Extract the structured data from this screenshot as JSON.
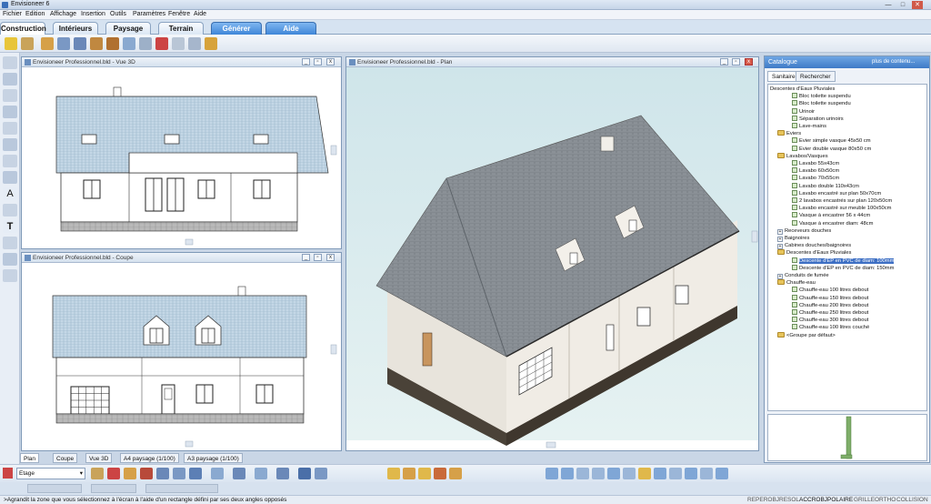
{
  "app": {
    "title": "Envisioneer 6"
  },
  "menu": [
    "Fichier",
    "Edition",
    "Affichage",
    "Insertion",
    "Outils",
    "Paramètres",
    "Fenêtre",
    "Aide"
  ],
  "tabs": [
    {
      "label": "Construction"
    },
    {
      "label": "Intérieurs"
    },
    {
      "label": "Paysage"
    },
    {
      "label": "Terrain"
    },
    {
      "label": "Générer"
    },
    {
      "label": "Aide"
    }
  ],
  "panels": {
    "vue3d": {
      "title": "Envisioneer Professionnel.bld - Vue 3D"
    },
    "coupe": {
      "title": "Envisioneer Professionnel.bld - Coupe"
    },
    "plan": {
      "title": "Envisioneer Professionnel.bld - Plan"
    }
  },
  "catalog": {
    "title": "Catalogue",
    "filter": "plus de contenu...",
    "tabs": [
      "Sanitaires",
      "Rechercher"
    ],
    "tree": [
      {
        "text": "Descentes d'Eaux Pluviales",
        "lvl": 0,
        "kind": "none"
      },
      {
        "text": "Bloc toilette suspendu",
        "lvl": 3,
        "kind": "item"
      },
      {
        "text": "Bloc toilette suspendu",
        "lvl": 3,
        "kind": "item"
      },
      {
        "text": "Urinoir",
        "lvl": 3,
        "kind": "item"
      },
      {
        "text": "Séparation urinoirs",
        "lvl": 3,
        "kind": "item"
      },
      {
        "text": "Lave-mains",
        "lvl": 3,
        "kind": "item"
      },
      {
        "text": "Eviers",
        "lvl": 1,
        "kind": "folder"
      },
      {
        "text": "Evier simple vasque 45x50 cm",
        "lvl": 3,
        "kind": "item"
      },
      {
        "text": "Evier double vasque 80x50 cm",
        "lvl": 3,
        "kind": "item"
      },
      {
        "text": "Lavabos/Vasques",
        "lvl": 1,
        "kind": "folder"
      },
      {
        "text": "Lavabo 55x43cm",
        "lvl": 3,
        "kind": "item"
      },
      {
        "text": "Lavabo 60x50cm",
        "lvl": 3,
        "kind": "item"
      },
      {
        "text": "Lavabo 70x55cm",
        "lvl": 3,
        "kind": "item"
      },
      {
        "text": "Lavabo double 110x43cm",
        "lvl": 3,
        "kind": "item"
      },
      {
        "text": "Lavabo encastré sur plan 50x70cm",
        "lvl": 3,
        "kind": "item"
      },
      {
        "text": "2 lavabos encastrés sur plan 120x50cm",
        "lvl": 3,
        "kind": "item"
      },
      {
        "text": "Lavabo encastré sur meuble 100x50cm",
        "lvl": 3,
        "kind": "item"
      },
      {
        "text": "Vasque à encastrer 56 x 44cm",
        "lvl": 3,
        "kind": "item"
      },
      {
        "text": "Vasque à encastrer diam: 48cm",
        "lvl": 3,
        "kind": "item"
      },
      {
        "text": "Receveurs douches",
        "lvl": 1,
        "kind": "plus"
      },
      {
        "text": "Baignoires",
        "lvl": 1,
        "kind": "plus"
      },
      {
        "text": "Cabines douches/baignoires",
        "lvl": 1,
        "kind": "plus"
      },
      {
        "text": "Descentes d'Eaux Pluviales",
        "lvl": 1,
        "kind": "folder"
      },
      {
        "text": "Descente d'EP en PVC de diam: 100mm",
        "lvl": 3,
        "kind": "item"
      },
      {
        "text": "Descente d'EP en PVC de diam: 150mm",
        "lvl": 3,
        "kind": "item"
      },
      {
        "text": "Conduits de fumée",
        "lvl": 1,
        "kind": "plus"
      },
      {
        "text": "Chauffe-eau",
        "lvl": 1,
        "kind": "folder"
      },
      {
        "text": "Chauffe-eau 100 litres debout",
        "lvl": 3,
        "kind": "item"
      },
      {
        "text": "Chauffe-eau 150 litres debout",
        "lvl": 3,
        "kind": "item"
      },
      {
        "text": "Chauffe-eau 200 litres debout",
        "lvl": 3,
        "kind": "item"
      },
      {
        "text": "Chauffe-eau 250 litres debout",
        "lvl": 3,
        "kind": "item"
      },
      {
        "text": "Chauffe-eau 300 litres debout",
        "lvl": 3,
        "kind": "item"
      },
      {
        "text": "Chauffe-eau 100 litres couché",
        "lvl": 3,
        "kind": "item"
      },
      {
        "text": "<Groupe par défaut>",
        "lvl": 1,
        "kind": "folder"
      }
    ]
  },
  "bottom_tabs": [
    "Plan",
    "Coupe",
    "Vue 3D",
    "A4 paysage (1/100)",
    "A3 paysage (1/100)"
  ],
  "layer": {
    "value": "Etage"
  },
  "status": {
    "hint": "Agrandit la zone que vous sélectionnez à l'écran à l'aide d'un rectangle défini par ses deux angles opposés",
    "modes": [
      "REPEROBJ",
      "RESOL",
      "ACCROBJ",
      "POLAIRE",
      "GRILLE",
      "ORTHO",
      "COLLISION"
    ]
  },
  "colors": {
    "roof": "#8a9096",
    "wall": "#e6e2da",
    "foundation": "#4a4238",
    "sky": "#d9ecee",
    "accent": "#3e7ac7"
  }
}
